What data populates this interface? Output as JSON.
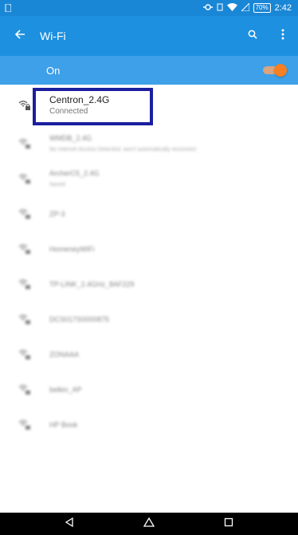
{
  "status_bar": {
    "time": "2:42",
    "battery": "70%"
  },
  "app_bar": {
    "title": "Wi-Fi"
  },
  "wifi_switch": {
    "label": "On",
    "state": "on",
    "accent": "#f57f22"
  },
  "connected_network": {
    "ssid": "Centron_2.4G",
    "status": "Connected",
    "highlight_color": "#1b1f9e"
  },
  "networks": [
    {
      "ssid": "WMDB_2.4G",
      "status": "No Internet Access Detected, won't automatically reconnect"
    },
    {
      "ssid": "ArcherC5_2.4G",
      "status": "Saved"
    },
    {
      "ssid": "ZP-3",
      "status": ""
    },
    {
      "ssid": "HomeneyWiFi",
      "status": ""
    },
    {
      "ssid": "TP-LINK_2.4GHz_8AF229",
      "status": ""
    },
    {
      "ssid": "DCS017S0000875",
      "status": ""
    },
    {
      "ssid": "ZONAAA",
      "status": ""
    },
    {
      "ssid": "belkin_AP",
      "status": ""
    },
    {
      "ssid": "HP Book",
      "status": ""
    }
  ],
  "colors": {
    "status_bar": "#1a87d6",
    "app_bar": "#1d90e0",
    "switch_bar": "#3ea0e8"
  },
  "icons": {
    "back": "arrow-left-icon",
    "search": "search-icon",
    "more": "more-vert-icon",
    "wifi_locked": "wifi-lock-icon",
    "nav_back": "triangle-back-icon",
    "nav_home": "home-icon",
    "nav_recents": "square-recents-icon"
  }
}
